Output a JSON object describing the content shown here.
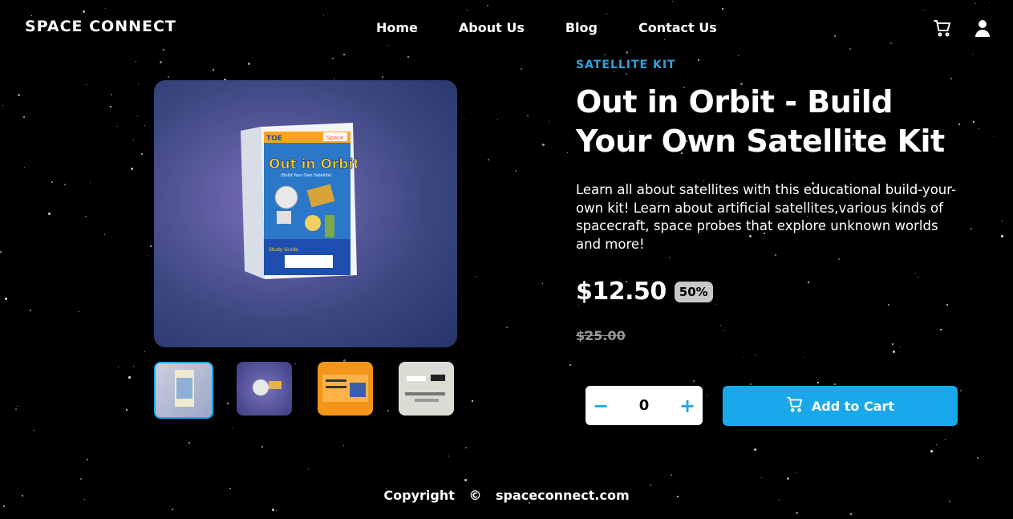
{
  "header": {
    "logo": "SPACE CONNECT",
    "nav": [
      "Home",
      "About Us",
      "Blog",
      "Contact Us"
    ],
    "icons": [
      "cart-icon",
      "user-icon"
    ]
  },
  "product": {
    "category": "SATELLITE KIT",
    "title": "Out in Orbit - Build Your Own Satellite Kit",
    "description": "Learn all about satellites with this educational build-your-own kit! Learn about artificial satellites,various kinds of spacecraft, space probes that explore unknown worlds and more!",
    "price": "$12.50",
    "discount": "50%",
    "old_price": "$25.00",
    "box_art": {
      "brand": "TOE",
      "tag": "Space",
      "title": "Out in Orbit",
      "subtitle": "(Build Your Own Satellite)",
      "badge": "Study Guide"
    }
  },
  "gallery": {
    "thumbnails": [
      "box-front",
      "satellite-model",
      "instructions",
      "kit-parts"
    ],
    "selected": 0
  },
  "cart": {
    "quantity": "0",
    "minus": "−",
    "plus": "+",
    "add_label": "Add to Cart"
  },
  "footer": {
    "copyright": "Copyright",
    "symbol": "©",
    "site": "spaceconnect.com"
  },
  "colors": {
    "background": "#000000",
    "accent": "#19a8ea",
    "text": "#ffffff"
  }
}
